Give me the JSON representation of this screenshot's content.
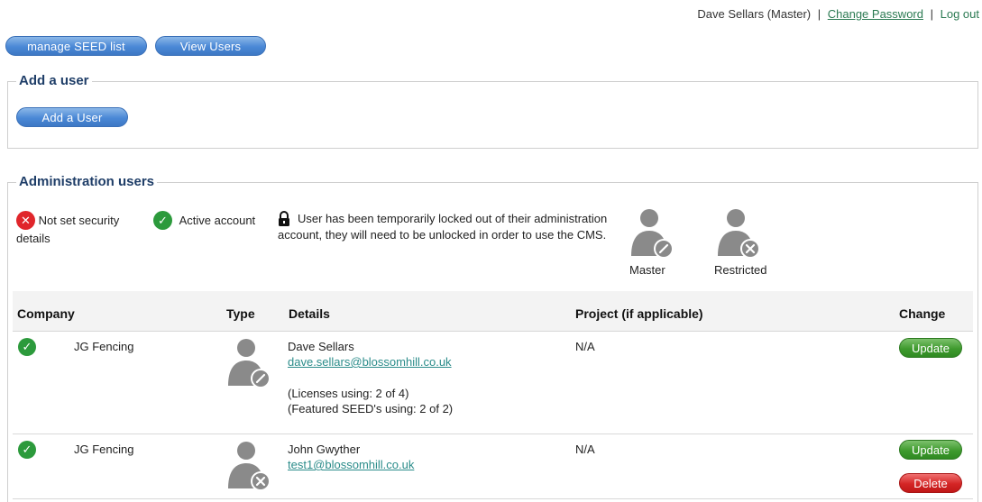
{
  "header": {
    "user_label": "Dave Sellars (Master)",
    "sep1": "|",
    "change_password": "Change Password",
    "sep2": "|",
    "logout": "Log out"
  },
  "nav": {
    "manage_seed": "manage SEED list",
    "view_users": "View Users"
  },
  "add_user_section": {
    "legend": "Add a user",
    "button": "Add a User"
  },
  "admin_section": {
    "legend": "Administration users",
    "key": {
      "not_set": "Not set security details",
      "active": "Active account",
      "locked": "User has been temporarily locked out of their administration account, they will need to be unlocked in order to use the CMS.",
      "master": "Master",
      "restricted": "Restricted"
    },
    "columns": [
      "Company",
      "Type",
      "Details",
      "Project (if applicable)",
      "Change"
    ],
    "rows": [
      {
        "company": "JG Fencing",
        "type": "Master",
        "name": "Dave Sellars",
        "email": "dave.sellars@blossomhill.co.uk",
        "licenses": "(Licenses using: 2 of 4)",
        "featured": "(Featured SEED's using: 2 of 2)",
        "project": "N/A",
        "update": "Update"
      },
      {
        "company": "JG Fencing",
        "type": "Restricted",
        "name": "John Gwyther",
        "email": "test1@blossomhill.co.uk",
        "project": "N/A",
        "update": "Update",
        "delete": "Delete"
      }
    ]
  },
  "colors": {
    "link": "#2b7a52",
    "legend_text": "#1f3e68",
    "pill_blue": "#4a88d6",
    "update_green": "#3f9a2e",
    "delete_red": "#d42525",
    "user_icon_gray": "#8a8a8a"
  },
  "icons": {
    "not_set": "x-circle-icon",
    "active": "check-circle-icon",
    "locked": "padlock-icon",
    "master": "user-edit-icon",
    "restricted": "user-x-icon"
  }
}
